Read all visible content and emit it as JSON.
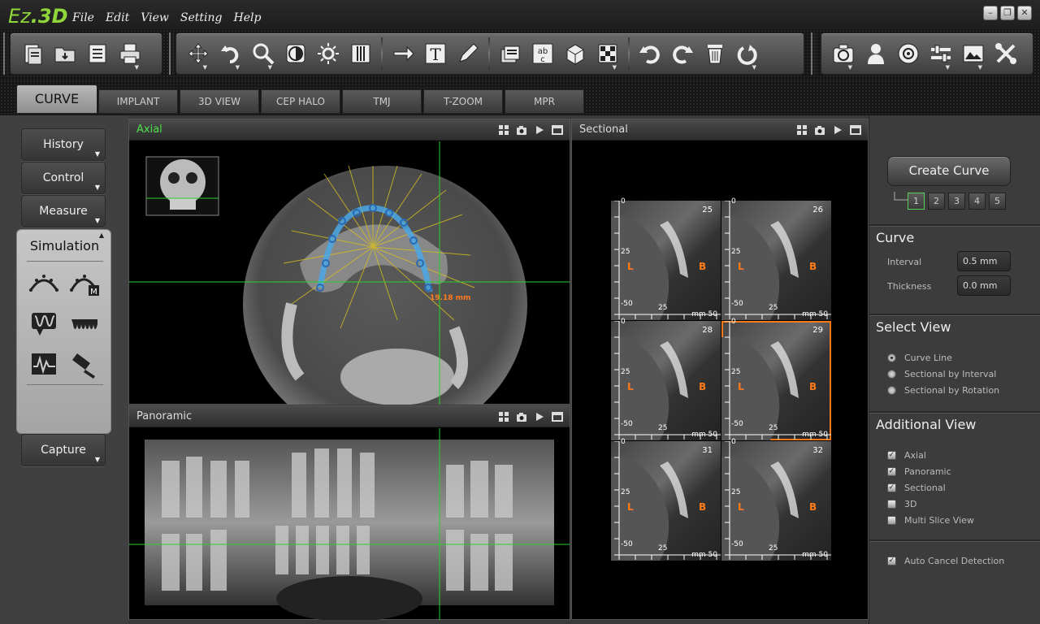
{
  "app": {
    "logo_prefix": "Ez",
    "logo_suffix": ".3D"
  },
  "menu": [
    "File",
    "Edit",
    "View",
    "Setting",
    "Help"
  ],
  "window_controls": [
    "minimize",
    "restore",
    "close"
  ],
  "tabs": [
    {
      "label": "CURVE",
      "active": true
    },
    {
      "label": "IMPLANT"
    },
    {
      "label": "3D VIEW"
    },
    {
      "label": "CEP HALO"
    },
    {
      "label": "TMJ"
    },
    {
      "label": "T-ZOOM"
    },
    {
      "label": "MPR"
    }
  ],
  "toolbar_icons": [
    "new-document-icon",
    "open-folder-icon",
    "save-icon",
    "print-icon",
    "move-icon",
    "undo-rotate-icon",
    "zoom-icon",
    "contrast-icon",
    "brightness-icon",
    "grid-icon",
    "arrow-icon",
    "text-icon",
    "pencil-icon",
    "layers-icon",
    "ab-label-icon",
    "cube-icon",
    "checker-icon",
    "undo-icon",
    "redo-icon",
    "trash-icon",
    "reset-icon",
    "camera-icon",
    "person-icon",
    "disc-icon",
    "sliders-icon",
    "image-icon",
    "tools-icon"
  ],
  "left_panel": {
    "history": "History",
    "control": "Control",
    "measure": "Measure",
    "simulation": "Simulation",
    "capture": "Capture"
  },
  "viewports": {
    "axial": {
      "title": "Axial",
      "measurement": "19.18 mm"
    },
    "panoramic": {
      "title": "Panoramic"
    },
    "sectional": {
      "title": "Sectional"
    }
  },
  "sectional_slices": [
    {
      "num": "25"
    },
    {
      "num": "26"
    },
    {
      "num": "28"
    },
    {
      "num": "29",
      "selected": true
    },
    {
      "num": "31"
    },
    {
      "num": "32"
    }
  ],
  "slice_ticks": {
    "top": "0",
    "mid": "25",
    "bottom": "-50",
    "xmid": "25",
    "xend": "50",
    "unit": "mm"
  },
  "slice_labels": {
    "left": "L",
    "right": "B"
  },
  "right_panel": {
    "create_curve": "Create Curve",
    "curve_numbers": [
      "1",
      "2",
      "3",
      "4",
      "5"
    ],
    "curve": {
      "heading": "Curve",
      "interval_label": "Interval",
      "interval_value": "0.5 mm",
      "thickness_label": "Thickness",
      "thickness_value": "0.0 mm"
    },
    "select_view": {
      "heading": "Select View",
      "options": [
        "Curve Line",
        "Sectional by Interval",
        "Sectional by Rotation"
      ],
      "selected": 0
    },
    "additional_view": {
      "heading": "Additional View",
      "options": [
        {
          "label": "Axial",
          "checked": true
        },
        {
          "label": "Panoramic",
          "checked": true
        },
        {
          "label": "Sectional",
          "checked": true
        },
        {
          "label": "3D",
          "checked": false
        },
        {
          "label": "Multi Slice View",
          "checked": false
        }
      ]
    },
    "auto_cancel": {
      "label": "Auto Cancel Detection",
      "checked": true
    }
  },
  "colors": {
    "accent_green": "#4ae04a",
    "curve_blue": "#4aa8e8",
    "label_orange": "#ff7a1a"
  }
}
